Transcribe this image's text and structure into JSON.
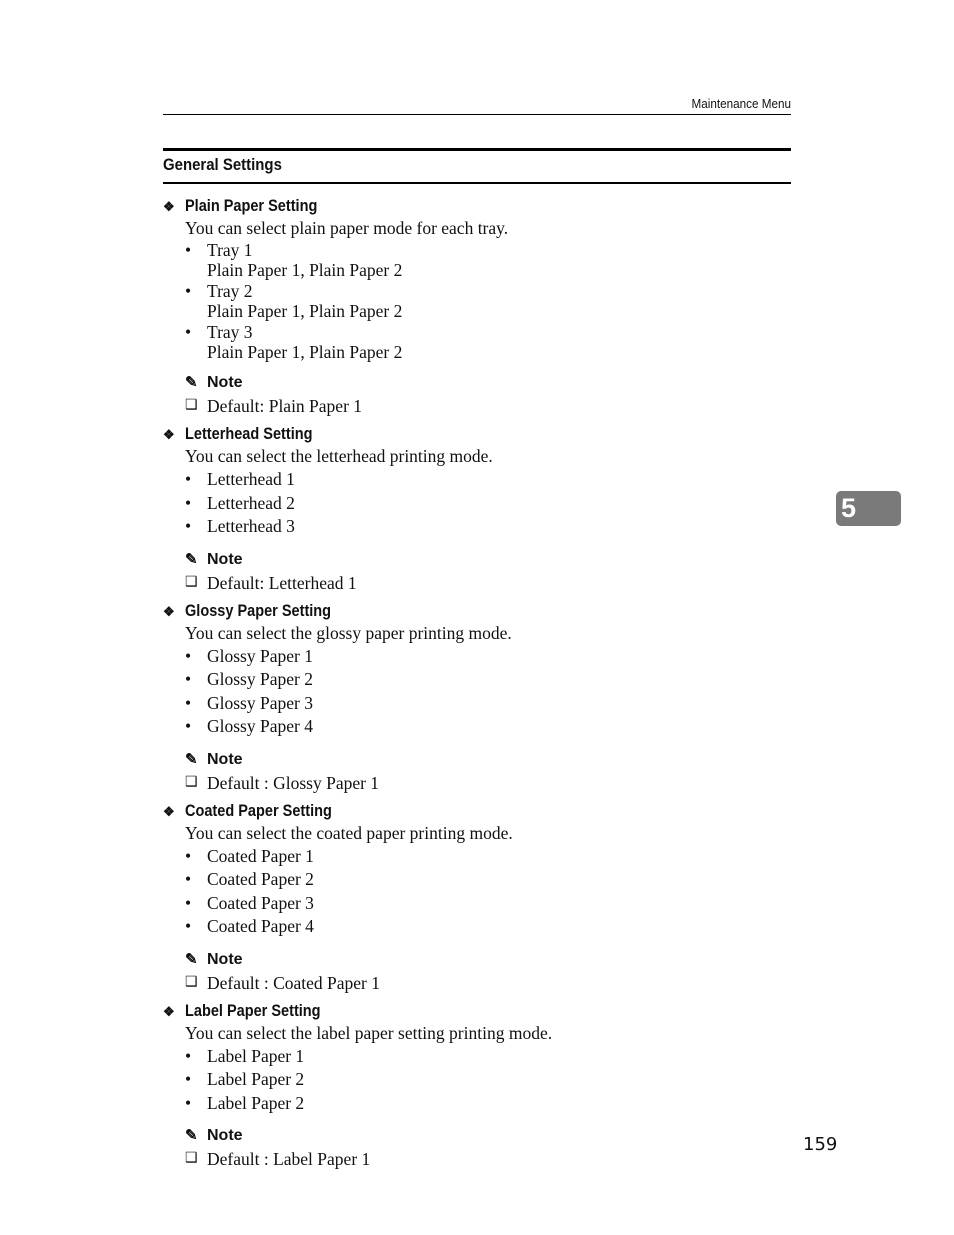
{
  "running_head": "Maintenance Menu",
  "section_title": "General Settings",
  "chapter_tab": "5",
  "page_number": "159",
  "icons": {
    "setting_marker": "diamond-cluster-icon",
    "note_marker": "pencil-icon",
    "default_marker": "checkbox-icon",
    "list_marker": "bullet-icon"
  },
  "settings": [
    {
      "title": "Plain Paper Setting",
      "description": "You can select plain paper mode for each tray.",
      "options": [
        {
          "label": "Tray 1",
          "sub": "Plain Paper 1, Plain Paper 2"
        },
        {
          "label": "Tray 2",
          "sub": "Plain Paper 1, Plain Paper 2"
        },
        {
          "label": "Tray 3",
          "sub": "Plain Paper 1, Plain Paper 2"
        }
      ],
      "note_label": "Note",
      "note": "Default: Plain Paper 1"
    },
    {
      "title": "Letterhead Setting",
      "description": "You can select the letterhead printing mode.",
      "options": [
        {
          "label": "Letterhead 1"
        },
        {
          "label": "Letterhead 2"
        },
        {
          "label": "Letterhead 3"
        }
      ],
      "note_label": "Note",
      "note": "Default: Letterhead 1"
    },
    {
      "title": "Glossy Paper Setting",
      "description": "You can select the glossy paper printing mode.",
      "options": [
        {
          "label": "Glossy Paper 1"
        },
        {
          "label": "Glossy Paper 2"
        },
        {
          "label": "Glossy Paper 3"
        },
        {
          "label": "Glossy Paper 4"
        }
      ],
      "note_label": "Note",
      "note": "Default : Glossy Paper 1"
    },
    {
      "title": "Coated Paper Setting",
      "description": "You can select the coated paper printing mode.",
      "options": [
        {
          "label": "Coated Paper 1"
        },
        {
          "label": "Coated Paper 2"
        },
        {
          "label": "Coated Paper 3"
        },
        {
          "label": "Coated Paper 4"
        }
      ],
      "note_label": "Note",
      "note": "Default : Coated Paper 1"
    },
    {
      "title": "Label Paper Setting",
      "description": "You can select the label paper setting printing mode.",
      "options": [
        {
          "label": "Label Paper 1"
        },
        {
          "label": "Label Paper 2"
        },
        {
          "label": "Label Paper 2"
        }
      ],
      "note_label": "Note",
      "note": "Default : Label Paper 1"
    }
  ]
}
